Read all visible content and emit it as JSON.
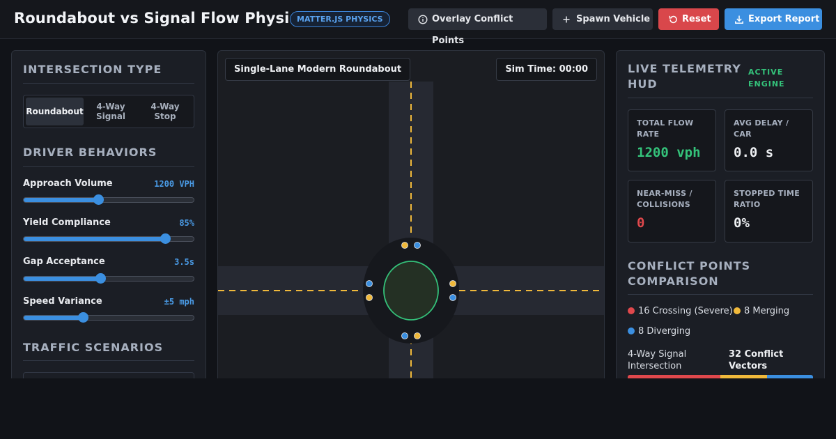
{
  "header": {
    "title": "Roundabout vs Signal Flow Physics",
    "badge": "MATTER.JS PHYSICS",
    "buttons": {
      "overlay": "Overlay Conflict Points",
      "spawn": "Spawn Vehicle",
      "reset": "Reset",
      "export": "Export Report"
    }
  },
  "left": {
    "intersection_title": "INTERSECTION TYPE",
    "intersection_types": [
      {
        "label": "Roundabout",
        "active": true
      },
      {
        "label": "4-Way Signal",
        "active": false
      },
      {
        "label": "4-Way Stop",
        "active": false
      }
    ],
    "behaviors_title": "DRIVER BEHAVIORS",
    "sliders": [
      {
        "label": "Approach Volume",
        "value": "1200 VPH",
        "fraction": 0.44
      },
      {
        "label": "Yield Compliance",
        "value": "85%",
        "fraction": 0.83
      },
      {
        "label": "Gap Acceptance",
        "value": "3.5s",
        "fraction": 0.45
      },
      {
        "label": "Speed Variance",
        "value": "±5 mph",
        "fraction": 0.35
      }
    ],
    "scenarios_title": "TRAFFIC SCENARIOS"
  },
  "center": {
    "mode_label": "Single-Lane Modern Roundabout",
    "sim_time_label": "Sim Time: 00:00"
  },
  "right": {
    "hud_title": "LIVE TELEMETRY HUD",
    "hud_status": "ACTIVE ENGINE",
    "stats": {
      "flow": {
        "label": "TOTAL FLOW RATE",
        "value": "1200 vph",
        "color": "#34c27a"
      },
      "delay": {
        "label": "AVG DELAY / CAR",
        "value": "0.0 s",
        "color": "#eef0f3"
      },
      "nearmiss": {
        "label": "NEAR-MISS / COLLISIONS",
        "value": "0",
        "color": "#e0484c"
      },
      "stopped": {
        "label": "STOPPED TIME RATIO",
        "value": "0%",
        "color": "#eef0f3"
      }
    },
    "conflict_title": "CONFLICT POINTS COMPARISON",
    "legend": {
      "crossing": {
        "label": "16 Crossing (Severe)",
        "color": "#e0484c"
      },
      "merging": {
        "label": "8 Merging",
        "color": "#f0b93b"
      },
      "diverging": {
        "label": "8 Diverging",
        "color": "#3b8fe0"
      }
    },
    "comparison": {
      "label": "4-Way Signal Intersection",
      "value": "32 Conflict Vectors",
      "segments": [
        16,
        8,
        8
      ]
    }
  },
  "colors": {
    "accent": "#3b8fe0",
    "danger": "#e0484c",
    "success": "#34c27a",
    "warning": "#f0b93b"
  }
}
